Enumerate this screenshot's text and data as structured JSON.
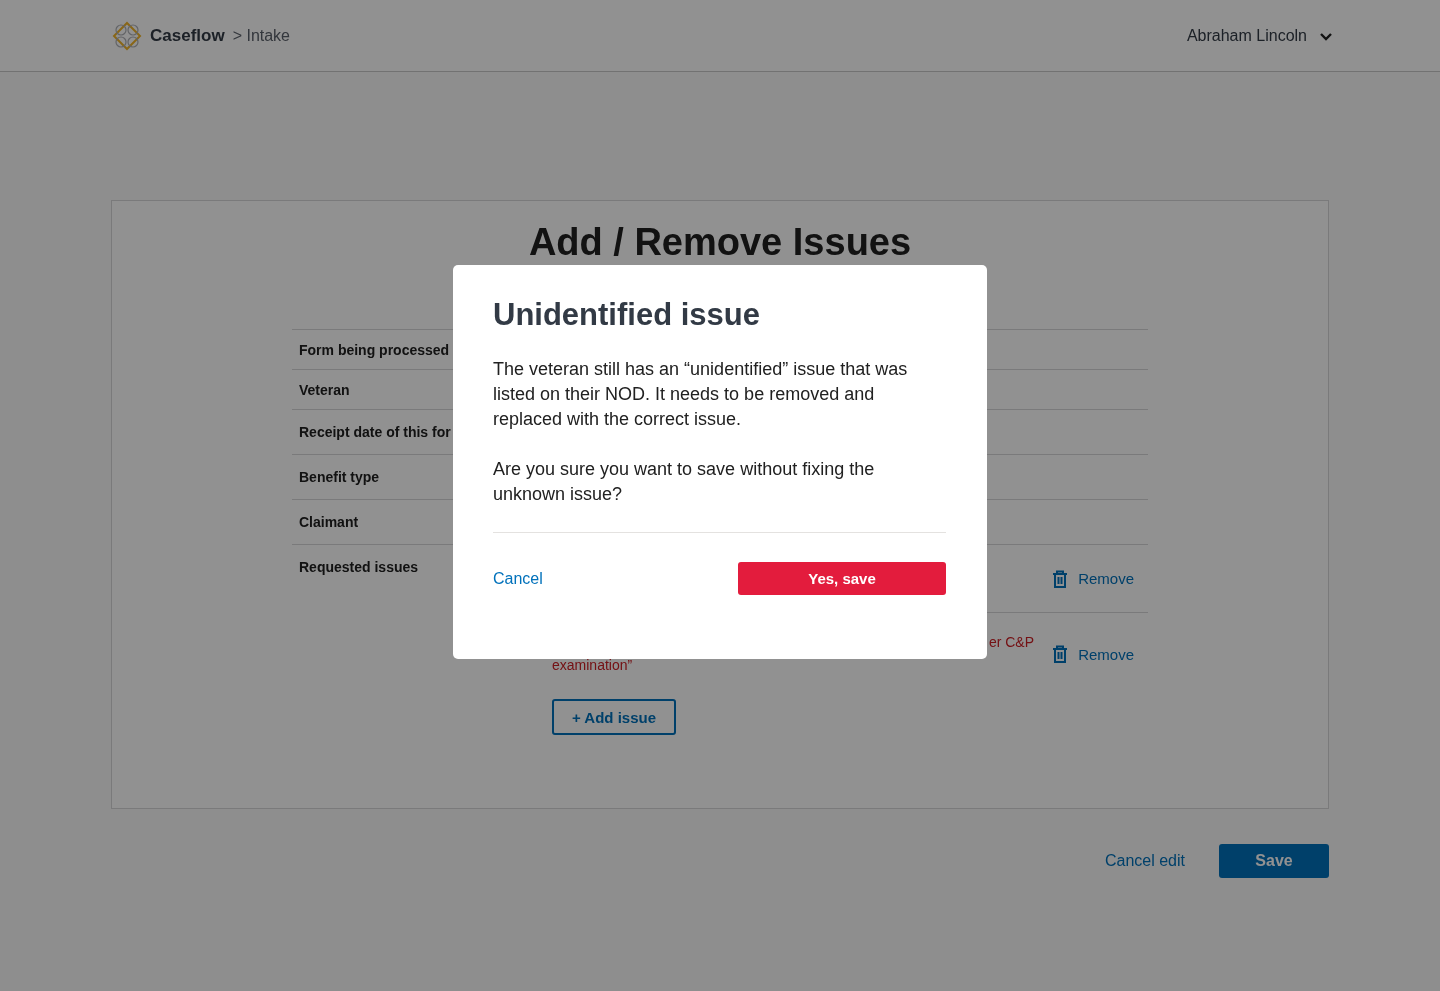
{
  "header": {
    "app_name": "Caseflow",
    "breadcrumb": "> Intake",
    "user_name": "Abraham Lincoln"
  },
  "page": {
    "title": "Add / Remove Issues",
    "fields": [
      {
        "label": "Form being processed"
      },
      {
        "label": "Veteran"
      },
      {
        "label": "Receipt date of this for"
      },
      {
        "label": "Benefit type"
      },
      {
        "label": "Claimant"
      }
    ],
    "requested_issues": {
      "label": "Requested issues",
      "issues": [
        {
          "remove": "Remove"
        },
        {
          "text_line_1": "er C&P",
          "text_line_2": "examination”",
          "remove": "Remove"
        }
      ],
      "add_button": "+ Add issue"
    },
    "cancel_link": "Cancel edit",
    "save_button": "Save"
  },
  "modal": {
    "title": "Unidentified issue",
    "paragraphs": [
      "The veteran still has an “unidentified” issue that was listed on their NOD. It needs to be removed and replaced with the correct issue.",
      "Are you sure you want to save without fixing the unknown issue?"
    ],
    "cancel": "Cancel",
    "confirm": "Yes, save"
  }
}
